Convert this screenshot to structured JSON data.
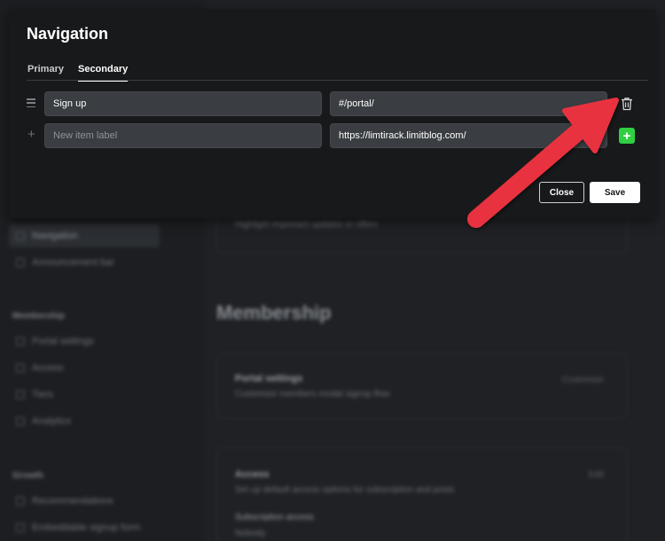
{
  "modal": {
    "title": "Navigation",
    "tabs": [
      {
        "label": "Primary",
        "active": false
      },
      {
        "label": "Secondary",
        "active": true
      }
    ],
    "items": [
      {
        "label": "Sign up",
        "url": "#/portal/"
      }
    ],
    "new_item": {
      "label_placeholder": "New item label",
      "url_value": "https://limtirack.limitblog.com/"
    },
    "close_label": "Close",
    "save_label": "Save"
  },
  "background": {
    "sidebar": [
      {
        "label": "Navigation",
        "active": true
      },
      {
        "label": "Announcement bar",
        "active": false
      }
    ],
    "membership_section": "Membership",
    "membership_items": [
      "Portal settings",
      "Access",
      "Tiers",
      "Analytics"
    ],
    "growth_section": "Growth",
    "growth_items": [
      "Recommendations",
      "Embeddable signup form"
    ],
    "announcement_card_desc": "Highlight important updates or offers",
    "heading": "Membership",
    "portal_card": {
      "title": "Portal settings",
      "desc": "Customize members modal signup flow",
      "action": "Customize"
    },
    "access_card": {
      "title": "Access",
      "desc": "Set up default access options for subscription and posts",
      "action": "Edit",
      "field_label": "Subscription access",
      "field_value": "Nobody"
    }
  },
  "colors": {
    "accent_green": "#30cf43",
    "annotation_arrow": "#e8333f",
    "modal_bg": "#18191b",
    "input_bg": "#3a3d41"
  },
  "icons": {
    "drag_handle": "drag-handle-icon",
    "delete": "trash-icon",
    "add": "plus-icon"
  }
}
